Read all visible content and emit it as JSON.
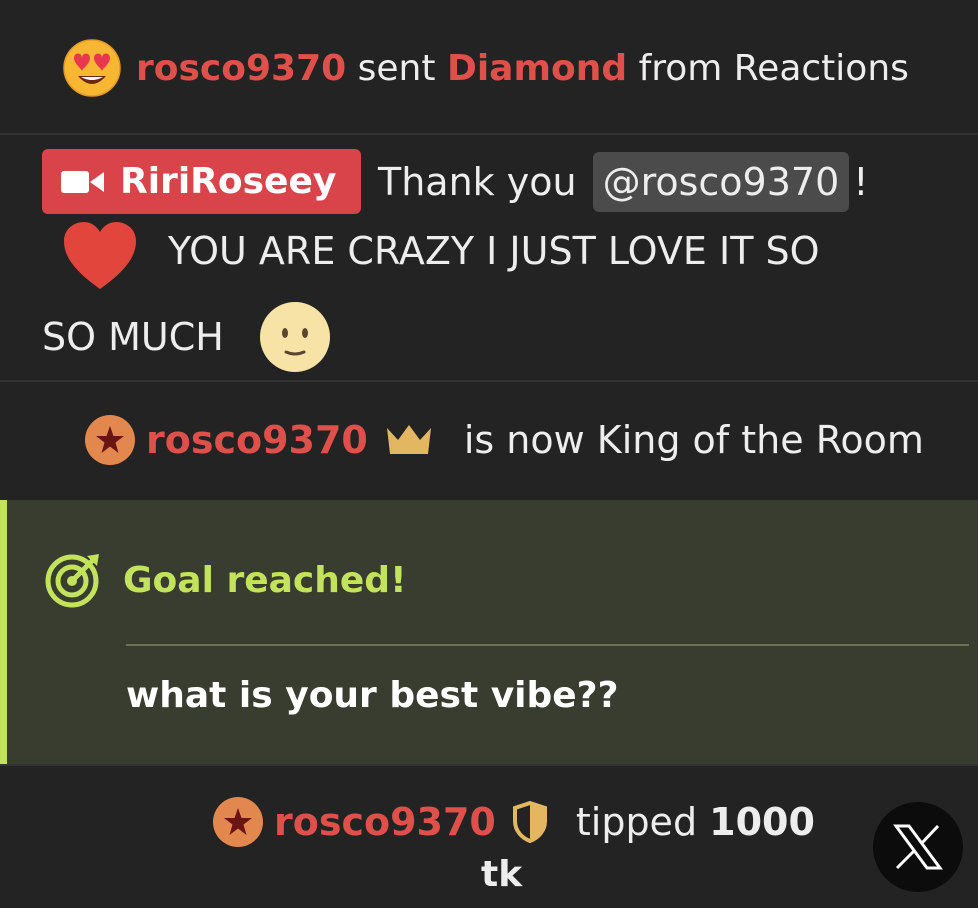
{
  "gift_event": {
    "username": "rosco9370",
    "sent_word": "sent",
    "gift_name": "Diamond",
    "from_text": "from Reactions",
    "emoji": "heart-eyes-emoji"
  },
  "chat_message": {
    "broadcaster_name": "RiriRoseey",
    "thanks_text": "Thank you",
    "mention": "@rosco9370",
    "exclamation": "!",
    "line1": "YOU ARE CRAZY I JUST LOVE IT SO",
    "line2": "SO MUCH",
    "heart_emoji": "red-heart-emoji",
    "end_emoji": "neutral-face-emoji"
  },
  "king_event": {
    "username": "rosco9370",
    "text": "is now King of the Room"
  },
  "goal": {
    "heading": "Goal reached!",
    "description": "what is your best vibe??"
  },
  "tip_event": {
    "username": "rosco9370",
    "tipped_word": "tipped",
    "amount": "1000",
    "unit": "tk"
  },
  "colors": {
    "background": "#232323",
    "username": "#e0504b",
    "badge": "#d9434a",
    "goal_accent": "#c4e35c",
    "goal_bg": "#383d2f"
  }
}
